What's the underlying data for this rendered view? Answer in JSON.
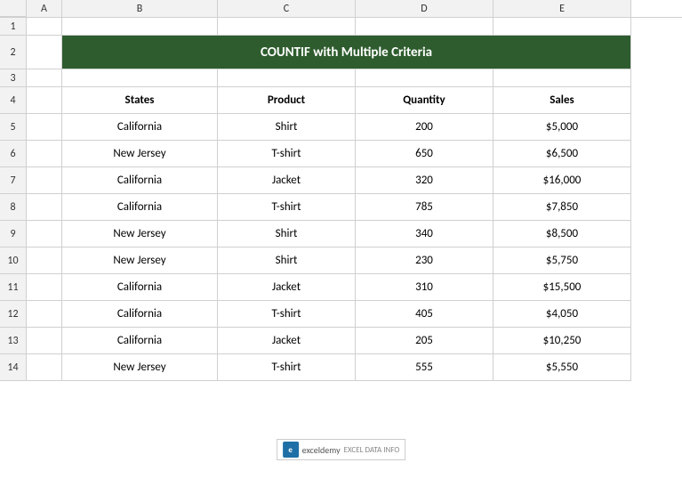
{
  "columns": {
    "a": "A",
    "b": "B",
    "c": "C",
    "d": "D",
    "e": "E"
  },
  "title": "COUNTIF with Multiple Criteria",
  "headers": {
    "states": "States",
    "product": "Product",
    "quantity": "Quantity",
    "sales": "Sales"
  },
  "rows": [
    {
      "row": "1",
      "states": "",
      "product": "",
      "quantity": "",
      "sales": ""
    },
    {
      "row": "2",
      "states": "",
      "product": "",
      "quantity": "",
      "sales": ""
    },
    {
      "row": "3",
      "states": "",
      "product": "",
      "quantity": "",
      "sales": ""
    },
    {
      "row": "4",
      "states": "States",
      "product": "Product",
      "quantity": "Quantity",
      "sales": "Sales"
    },
    {
      "row": "5",
      "states": "California",
      "product": "Shirt",
      "quantity": "200",
      "sales": "$5,000"
    },
    {
      "row": "6",
      "states": "New Jersey",
      "product": "T-shirt",
      "quantity": "650",
      "sales": "$6,500"
    },
    {
      "row": "7",
      "states": "California",
      "product": "Jacket",
      "quantity": "320",
      "sales": "$16,000"
    },
    {
      "row": "8",
      "states": "California",
      "product": "T-shirt",
      "quantity": "785",
      "sales": "$7,850"
    },
    {
      "row": "9",
      "states": "New Jersey",
      "product": "Shirt",
      "quantity": "340",
      "sales": "$8,500"
    },
    {
      "row": "10",
      "states": "New Jersey",
      "product": "Shirt",
      "quantity": "230",
      "sales": "$5,750"
    },
    {
      "row": "11",
      "states": "California",
      "product": "Jacket",
      "quantity": "310",
      "sales": "$15,500"
    },
    {
      "row": "12",
      "states": "California",
      "product": "T-shirt",
      "quantity": "405",
      "sales": "$4,050"
    },
    {
      "row": "13",
      "states": "California",
      "product": "Jacket",
      "quantity": "205",
      "sales": "$10,250"
    },
    {
      "row": "14",
      "states": "New Jersey",
      "product": "T-shirt",
      "quantity": "555",
      "sales": "$5,550"
    }
  ],
  "watermark": {
    "text": "exceldemy",
    "subtext": "EXCEL DATA INFO"
  }
}
